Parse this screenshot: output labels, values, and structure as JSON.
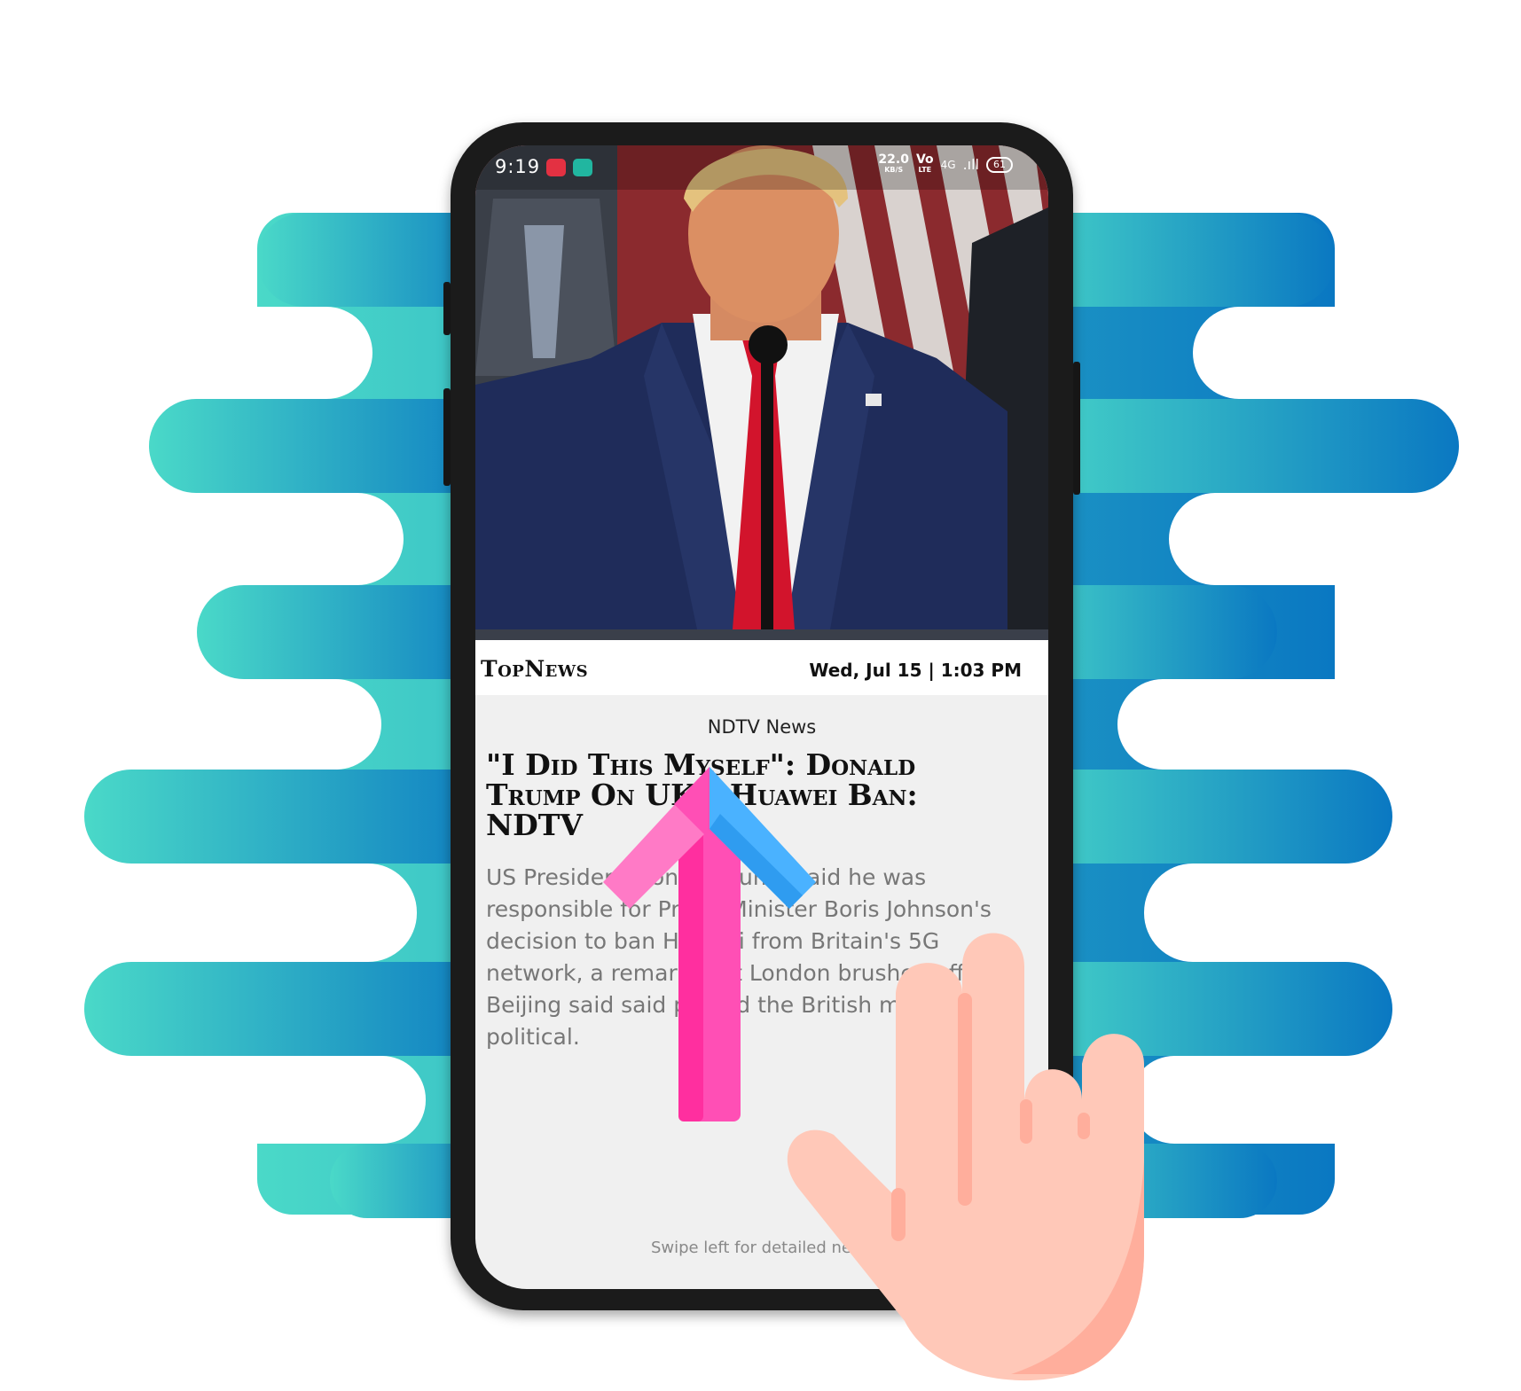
{
  "colors": {
    "blob_start": "#4ad9c8",
    "blob_end": "#0a78c2",
    "arrow_pink": "#ff4fb5",
    "arrow_pink_light": "#ff7ac6",
    "arrow_blue": "#4ab2ff",
    "hand": "#ffc8b8",
    "hand_shade": "#ffae9c"
  },
  "status_bar": {
    "time": "9:19",
    "net_speed": "22.0",
    "net_unit": "KB/S",
    "volte_top": "Vo",
    "volte_bottom": "LTE",
    "network": "4G",
    "signal": ".ıll",
    "battery": "61"
  },
  "app": {
    "brand": "TopNews",
    "datetime": "Wed, Jul 15 | 1:03 PM"
  },
  "article": {
    "source": "NDTV News",
    "headline": "\"I Did This Myself\": Donald Trump On UK's Huawei Ban: NDTV",
    "summary": "US President Donald Trump said he was responsible for Prime Minister Boris Johnson's decision to ban Huawei from Britain's 5G network, a remark that London brushed off and Beijing said said proved the British move was political.",
    "swipe_hint": "Swipe left for detailed news"
  },
  "icons": {
    "status_left_1": "screen-record-icon",
    "status_left_2": "chat-bubble-icon",
    "gesture_arrow": "arrow-up-icon",
    "gesture_hand": "two-finger-hand-icon"
  }
}
